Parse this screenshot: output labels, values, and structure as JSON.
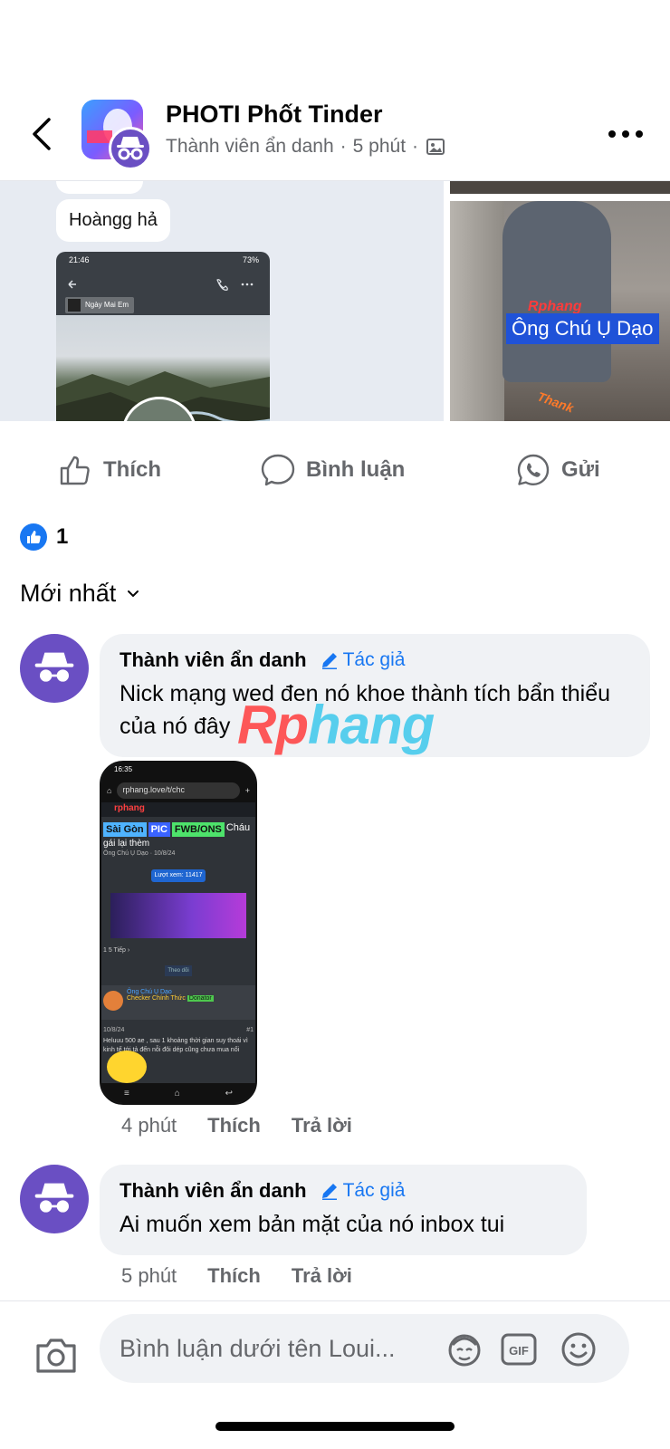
{
  "header": {
    "title": "PHOTI Phốt Tinder",
    "subtitle_author": "Thành viên ẩn danh",
    "subtitle_separator": "·",
    "subtitle_time": "5 phút",
    "subtitle_separator2": "·"
  },
  "post_media": {
    "chat_bubble_text": "Hoàngg hả",
    "phone_status_time": "21:46",
    "phone_status_battery": "73%",
    "song_chip": "Ngày Mai Em",
    "watermark_brand": "Rphang",
    "photo_label": "Ông Chú Ụ Dạo",
    "photo_corner_text": "Thank"
  },
  "actions": {
    "like": "Thích",
    "comment": "Bình luận",
    "send": "Gửi"
  },
  "reactions": {
    "count": "1"
  },
  "sort": {
    "label": "Mới nhất"
  },
  "comments": [
    {
      "author": "Thành viên ẩn danh",
      "badge": "Tác giả",
      "text": "Nick mạng wed đen nó khoe thành tích bẩn thiểu của nó đây",
      "time": "4 phút",
      "like": "Thích",
      "reply": "Trả lời",
      "image": {
        "status_time": "16:35",
        "url": "rphang.love/t/chc",
        "logo": "rphang",
        "tags": [
          "Sài Gòn",
          "PIC",
          "FWB/ONS"
        ],
        "title_rest": "Cháu",
        "title_line2": "gái lại thèm",
        "meta": "Ông Chú Ụ Dạo · 10/8/24",
        "views": "Lượt xem: 11417",
        "pages": "1   5   Tiếp ›",
        "follow": "Theo dõi",
        "user_name": "Ông Chú Ụ Dạo",
        "user_role": "Checker Chính Thức",
        "user_badge": "Donator",
        "post_date": "10/8/24",
        "post_num": "#1",
        "body": "Heluuu 500 ae , sau 1 khoảng thời gian suy thoái vì kinh tế tới tả đến nỗi đôi dép cũng chưa mua nổi"
      }
    },
    {
      "author": "Thành viên ẩn danh",
      "badge": "Tác giả",
      "text": "Ai muốn xem bản mặt của nó inbox tui",
      "time": "5 phút",
      "like": "Thích",
      "reply": "Trả lời"
    }
  ],
  "watermark": {
    "part1": "Rp",
    "part2": "hang"
  },
  "composer": {
    "placeholder": "Bình luận dưới tên Loui...",
    "gif_label": "GIF"
  },
  "colors": {
    "accent": "#1877f2",
    "anon_avatar": "#6a4fc3",
    "bubble_bg": "#f0f2f5",
    "secondary_text": "#65676b"
  }
}
